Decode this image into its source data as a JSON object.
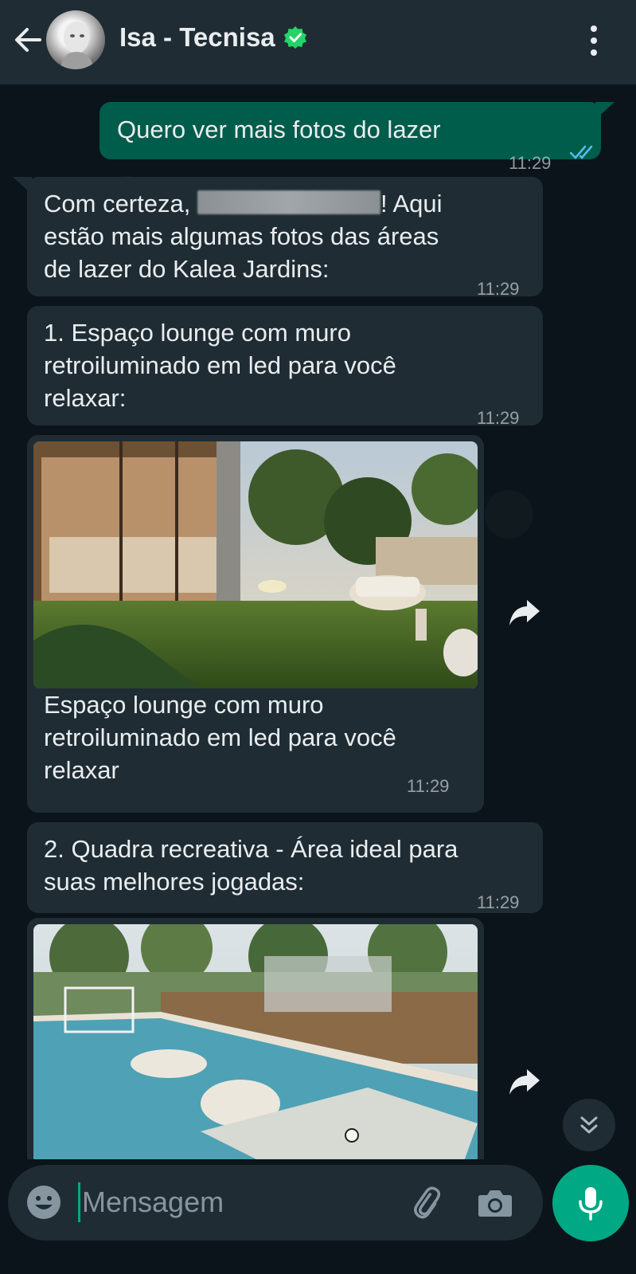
{
  "header": {
    "contact_name": "Isa - Tecnisa"
  },
  "messages": [
    {
      "text": "Quero ver mais fotos do lazer",
      "time": "11:29"
    },
    {
      "text_before": "Com certeza, ",
      "text_after": "! Aqui\nestão mais algumas fotos das áreas\nde lazer do Kalea Jardins:",
      "time": "11:29"
    },
    {
      "text": "1. Espaço lounge com muro\nretroiluminado em led para você\nrelaxar:",
      "time": "11:29"
    },
    {
      "caption": "Espaço lounge com muro\nretroiluminado em led para você\nrelaxar",
      "time": "11:29"
    },
    {
      "text": "2. Quadra recreativa - Área ideal para\nsuas melhores jogadas:",
      "time": "11:29"
    }
  ],
  "input": {
    "placeholder": "Mensagem"
  },
  "colors": {
    "outgoing_bubble": "#005c4b",
    "incoming_bubble": "#1f2c34",
    "accent": "#00a884",
    "read_ticks": "#53bdeb"
  }
}
